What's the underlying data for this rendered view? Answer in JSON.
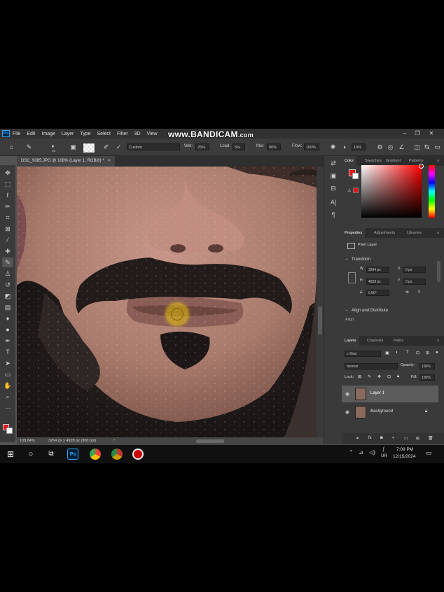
{
  "watermark": {
    "brand": "www.BANDICAM",
    "suffix": ".com"
  },
  "app": {
    "logo": "Ps"
  },
  "menu": [
    "File",
    "Edit",
    "Image",
    "Layer",
    "Type",
    "Select",
    "Filter",
    "3D",
    "View"
  ],
  "window_controls": {
    "minimize": "–",
    "restore": "❐",
    "close": "✕"
  },
  "options": {
    "brush_size": "10",
    "mode": "Custom",
    "wet_label": "Wet:",
    "wet_value": "25%",
    "load_label": "Load:",
    "load_value": "5%",
    "mix_label": "Mix:",
    "mix_value": "90%",
    "flow_label": "Flow:",
    "flow_value": "100%",
    "angle_value": "10%"
  },
  "document": {
    "tab_title": "DSC_9085.JPG @ 108% (Layer 1, RGB/8) *",
    "zoom": "108.84%",
    "size_info": "3264 px x 4928 px (300 ppi)"
  },
  "panels": {
    "color_tabs": [
      "Color",
      "Swatches",
      "Gradient",
      "Patterns"
    ],
    "properties_tabs": [
      "Properties",
      "Adjustments",
      "Libraries"
    ],
    "pixel_layer_label": "Pixel Layer",
    "transform_header": "Transform",
    "w_label": "W",
    "w_value": "3264 px",
    "h_label": "H",
    "h_value": "4928 px",
    "x_label": "X",
    "x_value": "0 px",
    "y_label": "Y",
    "y_value": "0 px",
    "angle_value": "0.00°",
    "align_header": "Align and Distribute",
    "align_label": "Align:",
    "layers_tabs": [
      "Layers",
      "Channels",
      "Paths"
    ],
    "kind_label": "Kind",
    "blend_mode": "Normal",
    "opacity_label": "Opacity:",
    "opacity_value": "100%",
    "lock_label": "Lock:",
    "fill_label": "Fill:",
    "fill_value": "100%",
    "layers": [
      {
        "name": "Layer 1"
      },
      {
        "name": "Background"
      }
    ]
  },
  "taskbar": {
    "time": "7:09 PM",
    "date": "12/15/2024",
    "lang": "UR"
  },
  "colors": {
    "foreground": "#e3161c",
    "background": "#ffffff",
    "color_picker_hue": "#ff0000"
  }
}
